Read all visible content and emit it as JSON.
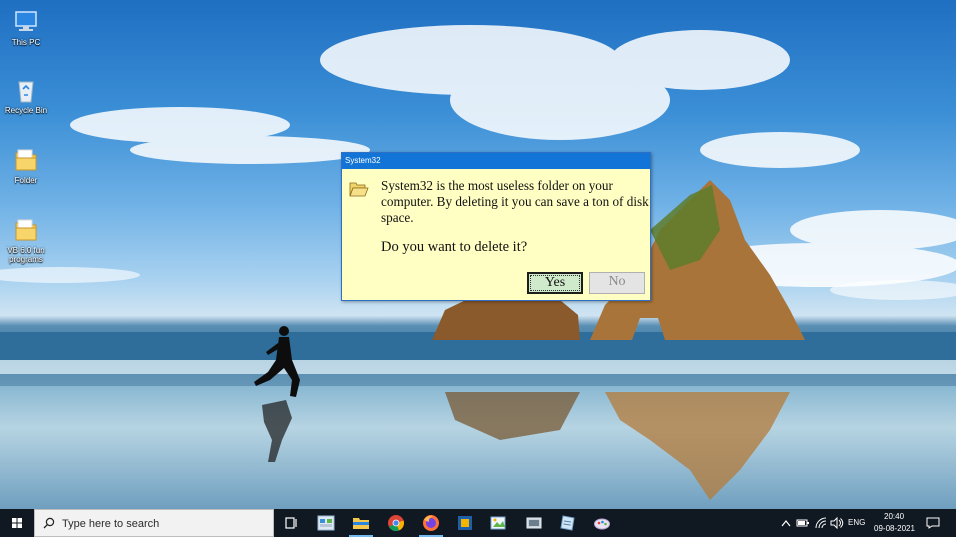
{
  "desktop": {
    "icons": [
      {
        "label": "This PC",
        "icon": "computer-icon"
      },
      {
        "label": "Recycle Bin",
        "icon": "recycle-bin-icon"
      },
      {
        "label": "Folder",
        "icon": "folder-icon"
      },
      {
        "label": "VB 6.0 fun programs",
        "icon": "folder-icon"
      }
    ]
  },
  "dialog": {
    "title": "System32",
    "message": "System32 is the most useless folder on your computer. By deleting it you can save a ton of disk space.",
    "question": "Do you want to delete it?",
    "yes_label": "Yes",
    "no_label": "No"
  },
  "taskbar": {
    "search_placeholder": "Type here to search",
    "apps": [
      "task-view-icon",
      "control-panel-icon",
      "file-explorer-icon",
      "chrome-icon",
      "firefox-icon",
      "virtualbox-icon",
      "paint-icon",
      "app-icon",
      "notepad-icon",
      "settings-icon"
    ],
    "tray": {
      "language": "ENG",
      "time": "20:40",
      "date": "09-08-2021"
    }
  },
  "colors": {
    "dialog_bg": "#ffffc4",
    "titlebar": "#1274d6",
    "yes_button": "#cfeacb",
    "taskbar": "#101822"
  }
}
